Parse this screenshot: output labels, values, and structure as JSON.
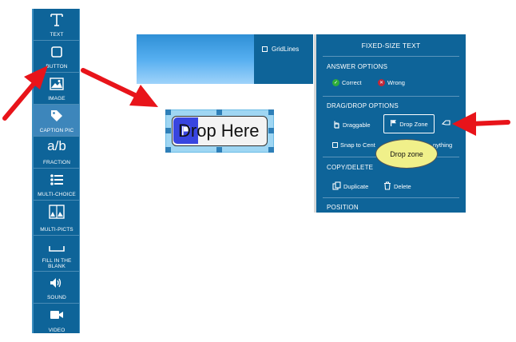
{
  "toolbar": {
    "tools": [
      {
        "label": "TEXT",
        "icon": "text-icon"
      },
      {
        "label": "BUTTON",
        "icon": "button-icon"
      },
      {
        "label": "IMAGE",
        "icon": "image-icon"
      },
      {
        "label": "CAPTION PIC",
        "icon": "tag-icon",
        "active": true
      },
      {
        "label": "a/b",
        "sub": "FRACTION",
        "icon": "fraction-icon"
      },
      {
        "label": "MULTI-CHOICE",
        "icon": "list-icon"
      },
      {
        "label": "MULTI-PICTS",
        "icon": "multi-picts-icon"
      },
      {
        "label": "FILL IN THE BLANK",
        "icon": "blank-icon"
      },
      {
        "label": "SOUND",
        "icon": "speaker-icon"
      },
      {
        "label": "VIDEO",
        "icon": "video-camera-icon"
      }
    ]
  },
  "canvas": {
    "gridlines_label": "GridLines",
    "widget_text": "Drop Here"
  },
  "panel": {
    "title": "FIXED-SIZE TEXT",
    "answer_options": {
      "heading": "ANSWER OPTIONS",
      "correct": "Correct",
      "wrong": "Wrong"
    },
    "dragdrop_options": {
      "heading": "DRAG/DROP OPTIONS",
      "draggable": "Draggable",
      "drop_zone": "Drop Zone",
      "snap": "Snap to Cent",
      "anything": "nything"
    },
    "copy_delete": {
      "heading": "COPY/DELETE",
      "duplicate": "Duplicate",
      "delete": "Delete"
    },
    "position": {
      "heading": "POSITION"
    }
  },
  "tooltip": {
    "text": "Drop zone"
  },
  "colors": {
    "panel_bg": "#0e6499",
    "arrow": "#e8141a",
    "bubble": "#f0f08a",
    "flag": "#3845e0"
  }
}
